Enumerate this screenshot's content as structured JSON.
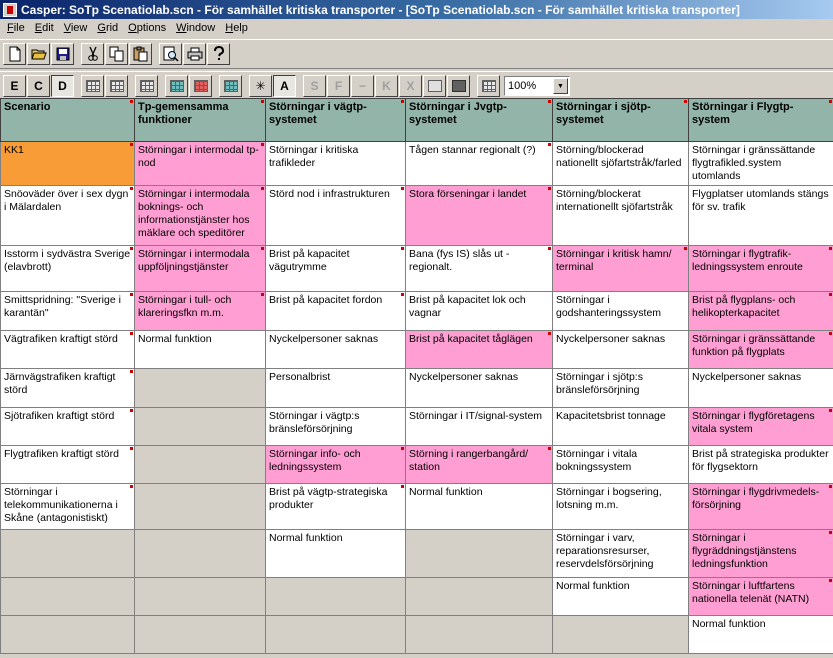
{
  "window": {
    "title": "Casper: SoTp Scenatiolab.scn - För samhället kritiska transporter - [SoTp Scenatiolab.scn - För samhället kritiska transporter]"
  },
  "menu": [
    {
      "label": "File",
      "ul": "F",
      "rest": "ile"
    },
    {
      "label": "Edit",
      "ul": "E",
      "rest": "dit"
    },
    {
      "label": "View",
      "ul": "V",
      "rest": "iew"
    },
    {
      "label": "Grid",
      "ul": "G",
      "rest": "rid"
    },
    {
      "label": "Options",
      "ul": "O",
      "rest": "ptions"
    },
    {
      "label": "Window",
      "ul": "W",
      "rest": "indow"
    },
    {
      "label": "Help",
      "ul": "H",
      "rest": "elp"
    }
  ],
  "toolbar2": {
    "e_label": "E",
    "c_label": "C",
    "d_label": "D",
    "star_label": "✳",
    "a_label": "A",
    "s_label": "S",
    "f_label": "F",
    "minus_label": "−",
    "k_label": "K",
    "x_label": "X",
    "zoom_value": "100%"
  },
  "grid": {
    "headers": [
      "Scenario",
      "Tp-gemensamma funktioner",
      "Störningar i vägtp-systemet",
      "Störningar i Jvgtp-systemet",
      "Störningar i sjötp-systemet",
      "Störningar i Flygtp-system"
    ],
    "rows": [
      [
        {
          "text": "KK1",
          "c": "o",
          "f": true
        },
        {
          "text": "Störningar i intermodal tp-nod",
          "c": "p",
          "f": true
        },
        {
          "text": "Störningar i kritiska trafikleder",
          "c": "w",
          "f": false
        },
        {
          "text": "Tågen stannar regionalt (?)",
          "c": "w",
          "f": true
        },
        {
          "text": "Störning/blockerad nationellt sjöfartstråk/farled",
          "c": "w",
          "f": false
        },
        {
          "text": "Störningar i gränssättande flygtrafikled.system utomlands",
          "c": "w",
          "f": false
        }
      ],
      [
        {
          "text": "Snöoväder över i sex dygn i Mälardalen",
          "c": "w",
          "f": true
        },
        {
          "text": "Störningar i intermodala boknings- och informationstjänster hos mäklare och speditörer",
          "c": "p",
          "f": true
        },
        {
          "text": "Störd nod i infrastrukturen",
          "c": "w",
          "f": true
        },
        {
          "text": "Stora förseningar i landet",
          "c": "p",
          "f": true
        },
        {
          "text": "Störning/blockerat internationellt sjöfartstråk",
          "c": "w",
          "f": false
        },
        {
          "text": "Flygplatser utomlands stängs för sv. trafik",
          "c": "w",
          "f": false
        }
      ],
      [
        {
          "text": "Isstorm i sydvästra Sverige (elavbrott)",
          "c": "w",
          "f": true
        },
        {
          "text": "Störningar i intermodala uppföljningstjänster",
          "c": "p",
          "f": true
        },
        {
          "text": "Brist på kapacitet vägutrymme",
          "c": "w",
          "f": true
        },
        {
          "text": "Bana (fys IS) slås ut - regionalt.",
          "c": "w",
          "f": true
        },
        {
          "text": "Störningar i kritisk hamn/ terminal",
          "c": "p",
          "f": true
        },
        {
          "text": "Störningar i flygtrafik-ledningssystem enroute",
          "c": "p",
          "f": true
        }
      ],
      [
        {
          "text": "Smittspridning: \"Sverige i karantän\"",
          "c": "w",
          "f": true
        },
        {
          "text": "Störningar i tull- och klareringsfkn m.m.",
          "c": "p",
          "f": true
        },
        {
          "text": "Brist på kapacitet fordon",
          "c": "w",
          "f": true
        },
        {
          "text": "Brist på kapacitet lok och vagnar",
          "c": "w",
          "f": false
        },
        {
          "text": "Störningar i godshanteringssystem",
          "c": "w",
          "f": false
        },
        {
          "text": "Brist på flygplans- och helikopterkapacitet",
          "c": "p",
          "f": true
        }
      ],
      [
        {
          "text": "Vägtrafiken kraftigt störd",
          "c": "w",
          "f": true
        },
        {
          "text": "Normal funktion",
          "c": "w",
          "f": false
        },
        {
          "text": "Nyckelpersoner saknas",
          "c": "w",
          "f": false
        },
        {
          "text": "Brist på kapacitet tåglägen",
          "c": "p",
          "f": true
        },
        {
          "text": "Nyckelpersoner saknas",
          "c": "w",
          "f": false
        },
        {
          "text": "Störningar i gränssättande funktion på flygplats",
          "c": "p",
          "f": true
        }
      ],
      [
        {
          "text": "Järnvägstrafiken kraftigt störd",
          "c": "w",
          "f": true
        },
        {
          "text": "",
          "c": "g",
          "f": false
        },
        {
          "text": "Personalbrist",
          "c": "w",
          "f": false
        },
        {
          "text": "Nyckelpersoner saknas",
          "c": "w",
          "f": false
        },
        {
          "text": "Störningar i sjötp:s bränsleförsörjning",
          "c": "w",
          "f": false
        },
        {
          "text": "Nyckelpersoner saknas",
          "c": "w",
          "f": false
        }
      ],
      [
        {
          "text": "Sjötrafiken kraftigt störd",
          "c": "w",
          "f": true
        },
        {
          "text": "",
          "c": "g",
          "f": false
        },
        {
          "text": "Störningar i vägtp:s bränsleförsörjning",
          "c": "w",
          "f": false
        },
        {
          "text": "Störningar i IT/signal-system",
          "c": "w",
          "f": false
        },
        {
          "text": "Kapacitetsbrist tonnage",
          "c": "w",
          "f": false
        },
        {
          "text": "Störningar i flygföretagens vitala system",
          "c": "p",
          "f": true
        }
      ],
      [
        {
          "text": "Flygtrafiken kraftigt störd",
          "c": "w",
          "f": true
        },
        {
          "text": "",
          "c": "g",
          "f": false
        },
        {
          "text": "Störningar info- och ledningssystem",
          "c": "p",
          "f": true
        },
        {
          "text": "Störning i rangerbangård/ station",
          "c": "p",
          "f": true
        },
        {
          "text": "Störningar i vitala bokningssystem",
          "c": "w",
          "f": false
        },
        {
          "text": "Brist på strategiska produkter för flygsektorn",
          "c": "w",
          "f": false
        }
      ],
      [
        {
          "text": "Störningar i telekommunikationerna i Skåne (antagonistiskt)",
          "c": "w",
          "f": true
        },
        {
          "text": "",
          "c": "g",
          "f": false
        },
        {
          "text": "Brist på vägtp-strategiska produkter",
          "c": "w",
          "f": true
        },
        {
          "text": "Normal funktion",
          "c": "w",
          "f": false
        },
        {
          "text": "Störningar i bogsering, lotsning m.m.",
          "c": "w",
          "f": false
        },
        {
          "text": "Störningar i flygdrivmedels-försörjning",
          "c": "p",
          "f": true
        }
      ],
      [
        {
          "text": "",
          "c": "g",
          "f": false
        },
        {
          "text": "",
          "c": "g",
          "f": false
        },
        {
          "text": "Normal funktion",
          "c": "w",
          "f": false
        },
        {
          "text": "",
          "c": "g",
          "f": false
        },
        {
          "text": "Störningar i varv, reparationsresurser, reservdelsförsörjning",
          "c": "w",
          "f": false
        },
        {
          "text": "Störningar i flygräddningstjänstens ledningsfunktion",
          "c": "p",
          "f": true
        }
      ],
      [
        {
          "text": "",
          "c": "g",
          "f": false
        },
        {
          "text": "",
          "c": "g",
          "f": false
        },
        {
          "text": "",
          "c": "g",
          "f": false
        },
        {
          "text": "",
          "c": "g",
          "f": false
        },
        {
          "text": "Normal funktion",
          "c": "w",
          "f": false
        },
        {
          "text": "Störningar i luftfartens nationella telenät (NATN)",
          "c": "p",
          "f": true
        }
      ],
      [
        {
          "text": "",
          "c": "g",
          "f": false
        },
        {
          "text": "",
          "c": "g",
          "f": false
        },
        {
          "text": "",
          "c": "g",
          "f": false
        },
        {
          "text": "",
          "c": "g",
          "f": false
        },
        {
          "text": "",
          "c": "g",
          "f": false
        },
        {
          "text": "Normal funktion",
          "c": "w",
          "f": false
        }
      ]
    ]
  }
}
